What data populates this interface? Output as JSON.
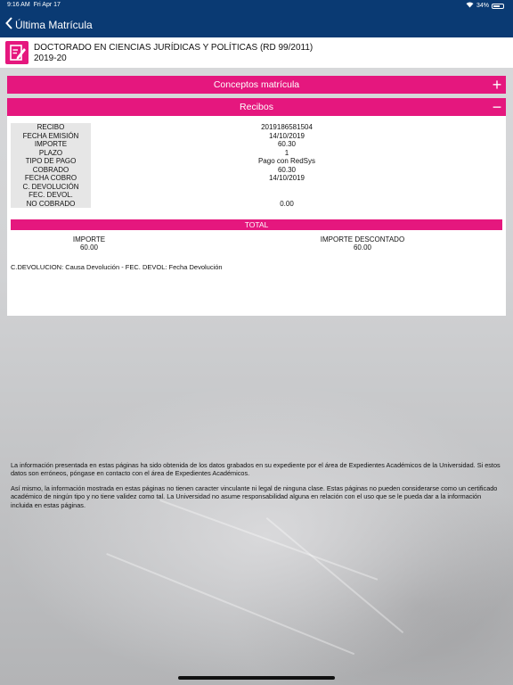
{
  "status_bar": {
    "time": "9:16 AM",
    "date": "Fri Apr 17",
    "battery": "34%"
  },
  "nav": {
    "back_label": "Última Matrícula"
  },
  "header": {
    "title": "DOCTORADO EN CIENCIAS JURÍDICAS Y POLÍTICAS (RD 99/2011)",
    "year": "2019-20",
    "icon": "edit-document-icon",
    "accent_color": "#e5177e"
  },
  "sections": {
    "conceptos": {
      "label": "Conceptos matrícula",
      "toggle": "+"
    },
    "recibos": {
      "label": "Recibos",
      "toggle": "−"
    }
  },
  "receipt": {
    "rows": [
      {
        "label": "RECIBO",
        "value": "2019186581504"
      },
      {
        "label": "FECHA EMISIÓN",
        "value": "14/10/2019"
      },
      {
        "label": "IMPORTE",
        "value": "60.30"
      },
      {
        "label": "PLAZO",
        "value": "1"
      },
      {
        "label": "TIPO DE PAGO",
        "value": "Pago con RedSys"
      },
      {
        "label": "COBRADO",
        "value": "60.30"
      },
      {
        "label": "FECHA COBRO",
        "value": "14/10/2019"
      },
      {
        "label": "C. DEVOLUCIÓN",
        "value": ""
      },
      {
        "label": "FEC. DEVOL.",
        "value": ""
      },
      {
        "label": "NO COBRADO",
        "value": "0.00"
      }
    ]
  },
  "total": {
    "label": "TOTAL",
    "importe_label": "IMPORTE",
    "importe_value": "60.00",
    "descontado_label": "IMPORTE DESCONTADO",
    "descontado_value": "60.00"
  },
  "legend_note": "C.DEVOLUCION: Causa Devolución - FEC. DEVOL: Fecha Devolución",
  "footer": {
    "p1": "La información presentada en estas páginas ha sido obtenida de los datos grabados en su expediente por el área de Expedientes Académicos de la Universidad. Si estos datos son erróneos, póngase en contacto con el área de Expedientes Académicos.",
    "p2": "Así mismo, la información mostrada en estas páginas no tienen caracter vinculante ni legal de ninguna clase. Estas páginas no pueden considerarse como un certificado académico de ningún tipo y no tiene validez como tal. La Universidad no asume responsabilidad alguna en relación con el uso que se le pueda dar a la información incluida en estas páginas."
  }
}
